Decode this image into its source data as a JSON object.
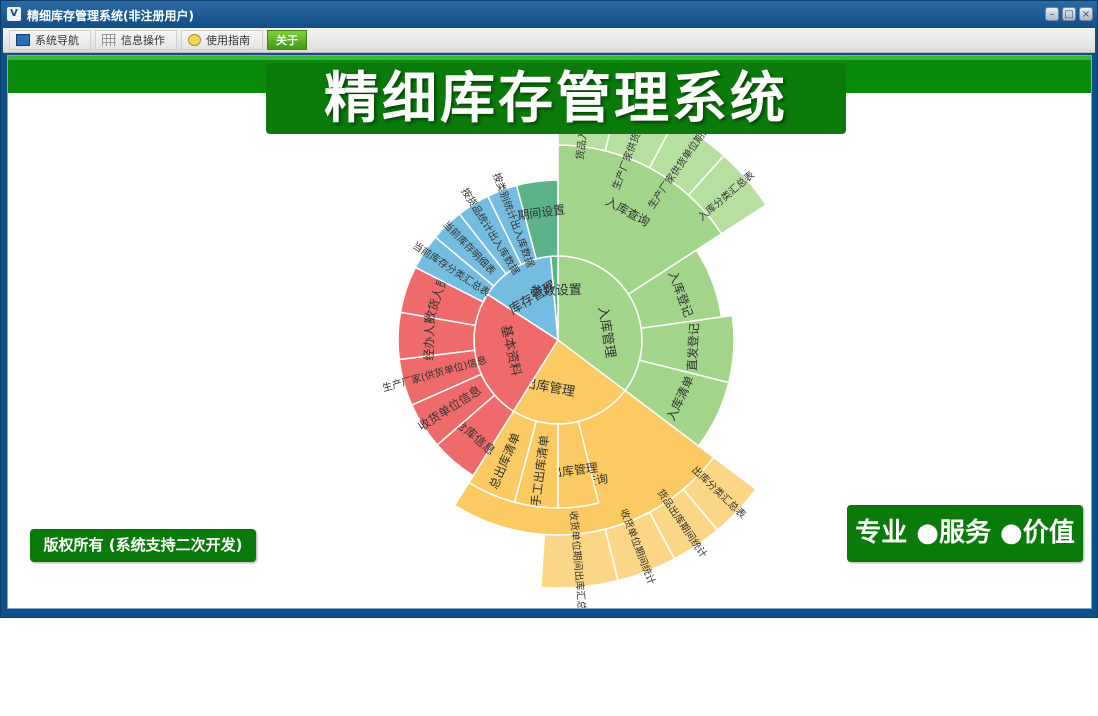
{
  "window": {
    "title": "精细库存管理系统(非注册用户)"
  },
  "menu": [
    {
      "label": "系统导航",
      "icon": "monitor-icon"
    },
    {
      "label": "信息操作",
      "icon": "grid-icon"
    },
    {
      "label": "使用指南",
      "icon": "help-icon"
    },
    {
      "label": "关于",
      "icon": ""
    }
  ],
  "banner": {
    "title": "精细库存管理系统"
  },
  "footer": {
    "copyright": "版权所有 (系统支持二次开发)",
    "slogan": "专业 ●服务 ●价值"
  },
  "colors": {
    "green": "#a2d48a",
    "green_light": "#b7df9f",
    "orange": "#fbca63",
    "orange_light": "#fcd687",
    "red": "#ee6a6b",
    "red_light": "#f1837f",
    "blue": "#74bde0",
    "blue_light": "#95cbe6",
    "teal": "#5cb38a",
    "brand_green": "#0a7a0a"
  },
  "sunburst": {
    "groups": [
      {
        "name": "入库管理",
        "color": "green",
        "start": 0,
        "end": 162,
        "children": [
          {
            "name": "入库查询",
            "start": 0,
            "end": 57,
            "r2": 195,
            "children": [
              {
                "name": "货品入库期间统计",
                "start": 0,
                "end": 14
              },
              {
                "name": "生产厂家供货单位期间统计",
                "start": 14,
                "end": 28
              },
              {
                "name": "生产厂家供货单位期间汇总",
                "start": 28,
                "end": 42
              },
              {
                "name": "入库分类汇总表",
                "start": 42,
                "end": 57
              }
            ]
          },
          {
            "name": "入库登记",
            "start": 57,
            "end": 82,
            "r2": 165
          },
          {
            "name": "直发登记",
            "start": 82,
            "end": 104,
            "r2": 176
          },
          {
            "name": "入库清单",
            "start": 104,
            "end": 127,
            "r2": 176
          }
        ]
      },
      {
        "name": "出库管理",
        "color": "orange",
        "start": 127,
        "end": 254,
        "children": [
          {
            "name": "出库查询",
            "start": 127,
            "end": 212,
            "r2": 195,
            "children": [
              {
                "name": "出库分类汇总表",
                "start": 127,
                "end": 140
              },
              {
                "name": "货品出库期间统计",
                "start": 140,
                "end": 152
              },
              {
                "name": "收货单位期间统计",
                "start": 152,
                "end": 166
              },
              {
                "name": "收货单位期间出库汇总",
                "start": 166,
                "end": 184
              }
            ]
          },
          {
            "name": "出库管理",
            "start": 166,
            "end": 180,
            "r2": 168
          },
          {
            "name": "手工出库清单",
            "start": 180,
            "end": 195,
            "r2": 168
          },
          {
            "name": "总出库清单",
            "start": 195,
            "end": 212,
            "r2": 168
          }
        ]
      },
      {
        "name": "基本资料",
        "color": "red",
        "start": 212,
        "end": 303,
        "children": [
          {
            "name": "仓库信息",
            "start": 212,
            "end": 229
          },
          {
            "name": "收货单位信息",
            "start": 229,
            "end": 246
          },
          {
            "name": "生产厂家(供货单位)信息",
            "start": 246,
            "end": 263
          },
          {
            "name": "经办人员",
            "start": 263,
            "end": 280
          },
          {
            "name": "收货人员",
            "start": 280,
            "end": 297
          }
        ]
      },
      {
        "name": "库存管理",
        "color": "blue",
        "start": 303,
        "end": 355,
        "children": [
          {
            "name": "当前库存分类汇总表",
            "start": 297,
            "end": 310
          },
          {
            "name": "当前库存明细表",
            "start": 310,
            "end": 322
          },
          {
            "name": "按货品统计出入库数据",
            "start": 322,
            "end": 334
          },
          {
            "name": "按类别统计出入库数据",
            "start": 334,
            "end": 345
          }
        ]
      },
      {
        "name": "参数设置",
        "color": "teal",
        "start": 355,
        "end": 360,
        "children": [
          {
            "name": "期间设置",
            "start": 345,
            "end": 360
          }
        ]
      }
    ]
  }
}
